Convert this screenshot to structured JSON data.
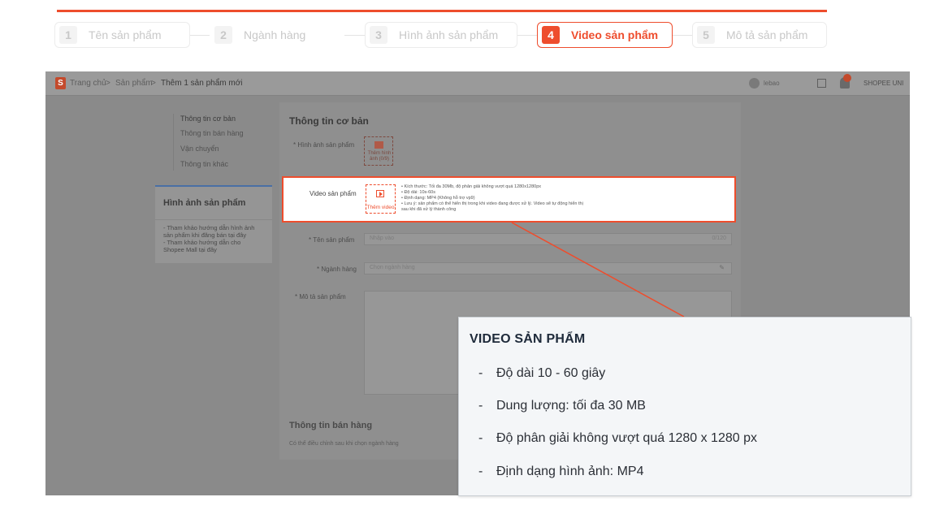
{
  "stepper": {
    "steps": [
      {
        "num": "1",
        "label": "Tên sản phẩm",
        "active": false
      },
      {
        "num": "2",
        "label": "Ngành hàng",
        "active": false
      },
      {
        "num": "3",
        "label": "Hình ảnh sản phẩm",
        "active": false
      },
      {
        "num": "4",
        "label": "Video sản phẩm",
        "active": true
      },
      {
        "num": "5",
        "label": "Mô tả sản phẩm",
        "active": false
      }
    ]
  },
  "screenshot": {
    "breadcrumb": {
      "home": "Trang chủ",
      "products": "Sản phẩm",
      "current": "Thêm 1 sản phẩm mới"
    },
    "user_name": "lebao",
    "shop_label": "SHOPEE UNI",
    "side_menu": [
      "Thông tin cơ bản",
      "Thông tin bán hàng",
      "Vận chuyển",
      "Thông tin khác"
    ],
    "left_card": {
      "title": "Hình ảnh sản phẩm",
      "notes": [
        "- Tham khảo hướng dẫn hình ảnh",
        "sản phẩm khi đăng bán tại đây",
        "- Tham khảo hướng dẫn cho",
        "Shopee Mall tại đây"
      ]
    },
    "main_title": "Thông tin cơ bản",
    "image_field_label": "* Hình ảnh sản phẩm",
    "image_tile_label": "Thêm hình ảnh (0/9)",
    "video_field_label": "Video sản phẩm",
    "video_tile_label": "Thêm video",
    "video_specs": [
      "•  Kích thước: Tối đa 30Mb, độ phân giải không vượt quá 1280x1280px",
      "•  Độ dài: 10s-60s",
      "•  Định dạng: MP4 (Không hỗ trợ vp9)",
      "•  Lưu ý: sản phẩm có thể hiển thị trong khi video đang được xử lý. Video sẽ tự động hiển thị",
      "   sau khi đã xử lý thành công"
    ],
    "name_field_label": "* Tên sản phẩm",
    "name_placeholder": "Nhập vào",
    "name_counter": "0/120",
    "category_field_label": "* Ngành hàng",
    "category_placeholder": "Chọn ngành hàng",
    "desc_field_label": "* Mô tả sản phẩm",
    "sales_section_title": "Thông tin bán hàng",
    "sales_section_note": "Có thể điều chỉnh sau khi chọn ngành hàng"
  },
  "info_card": {
    "title": "VIDEO SẢN PHẨM",
    "items": [
      "Độ dài 10 - 60 giây",
      "Dung lượng: tối đa 30 MB",
      "Độ phân giải không vượt quá 1280 x 1280 px",
      "Định dạng hình ảnh: MP4"
    ]
  },
  "colors": {
    "accent": "#ee4d2d",
    "overlay": "#8a8a8a",
    "card": "#f4f6f8"
  }
}
